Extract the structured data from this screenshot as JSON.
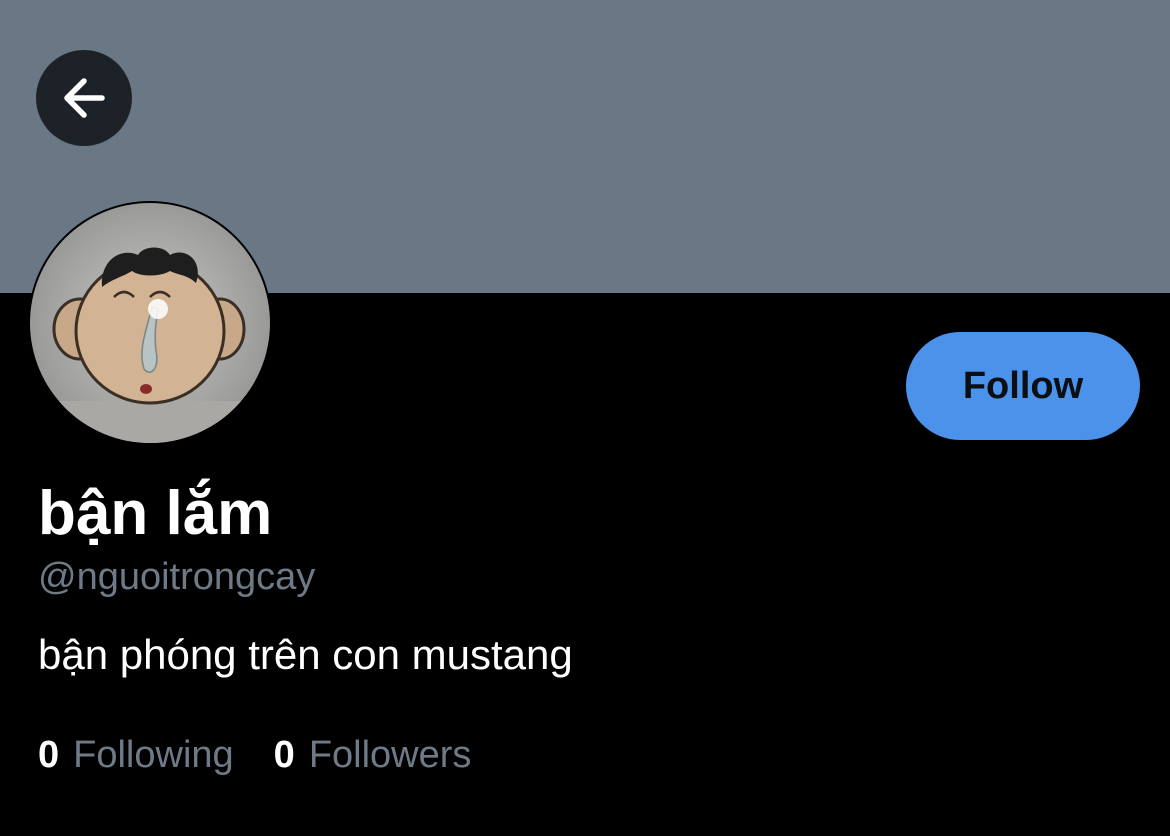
{
  "header": {
    "back_icon": "arrow-left-icon",
    "banner_color": "#6a7885"
  },
  "profile": {
    "display_name": "bận lắm",
    "handle": "@nguoitrongcay",
    "bio": "bận phóng trên con mustang",
    "follow_label": "Follow",
    "follow_color": "#4a92ea"
  },
  "stats": {
    "following_count": "0",
    "following_label": "Following",
    "followers_count": "0",
    "followers_label": "Followers"
  }
}
